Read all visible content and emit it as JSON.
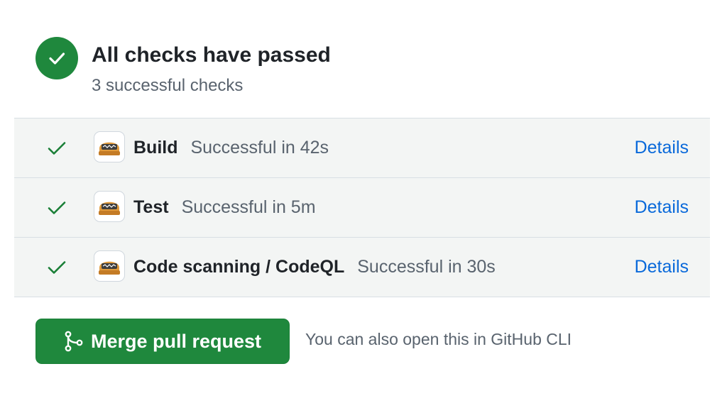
{
  "header": {
    "title": "All checks have passed",
    "subtitle": "3 successful checks",
    "status_icon": "check-circle-icon",
    "status_color": "#1f883d"
  },
  "checks": [
    {
      "name": "Build",
      "status": "Successful in 42s",
      "details": "Details",
      "icon": "check-icon",
      "app_icon": "actions-bot-avatar"
    },
    {
      "name": "Test",
      "status": "Successful in 5m",
      "details": "Details",
      "icon": "check-icon",
      "app_icon": "actions-bot-avatar"
    },
    {
      "name": "Code scanning / CodeQL",
      "status": "Successful in 30s",
      "details": "Details",
      "icon": "check-icon",
      "app_icon": "actions-bot-avatar"
    }
  ],
  "merge": {
    "button_label": "Merge pull request",
    "icon": "git-merge-icon",
    "cli_hint": "You can also open this in GitHub CLI"
  },
  "colors": {
    "success": "#1f883d",
    "link": "#0969da",
    "muted": "#59636e",
    "row_bg": "#f3f5f4"
  }
}
